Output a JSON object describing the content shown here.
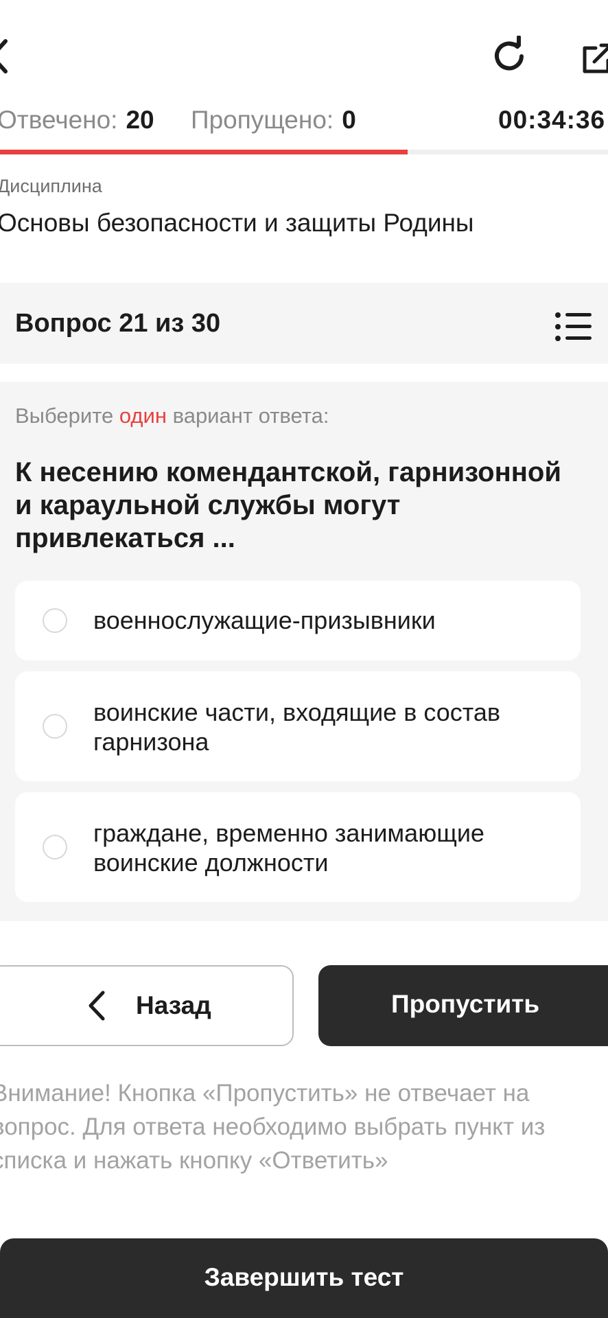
{
  "header": {
    "answered_label": "Отвечено:",
    "answered_value": "20",
    "skipped_label": "Пропущено:",
    "skipped_value": "0",
    "timer": "00:34:36",
    "progress_fraction": 0.67
  },
  "discipline": {
    "label": "Дисциплина",
    "title": "Основы безопасности и защиты Родины"
  },
  "question": {
    "counter": "Вопрос 21 из 30",
    "hint_before": "Выберите ",
    "hint_accent": "один",
    "hint_after": " вариант ответа:",
    "text": "К несению комендантской, гарнизонной и караульной службы могут привлекаться ...",
    "options": [
      {
        "label": "военнослужащие-призывники"
      },
      {
        "label": "воинские части, входящие в состав гарнизона"
      },
      {
        "label": "граждане, временно занимающие воинские должности"
      }
    ]
  },
  "actions": {
    "back_label": "Назад",
    "skip_label": "Пропустить",
    "finish_label": "Завершить тест"
  },
  "warning": "Внимание! Кнопка «Пропустить» не отвечает на вопрос. Для ответа необходимо выбрать пункт из списка и нажать кнопку «Ответить»",
  "colors": {
    "accent": "#e84040",
    "dark_button": "#2b2b2b",
    "card_background": "#f5f5f5"
  },
  "icons": {
    "back": "chevron-left-icon",
    "reload": "reload-icon",
    "external": "external-link-icon",
    "question_list": "list-icon",
    "back_button": "chevron-left-icon"
  }
}
